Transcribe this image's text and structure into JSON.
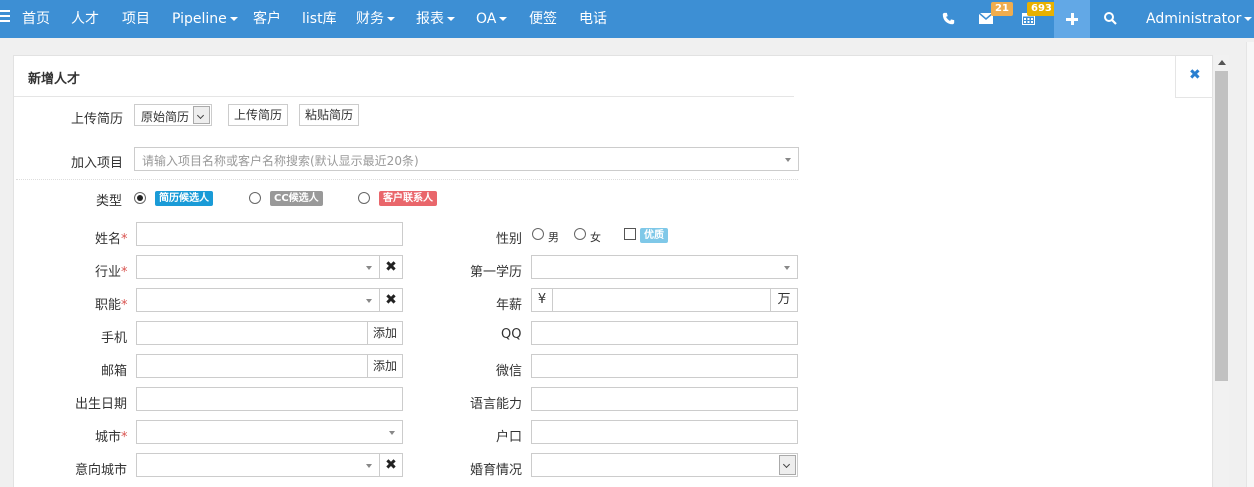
{
  "nav": {
    "items": [
      {
        "label": "首页",
        "dropdown": false
      },
      {
        "label": "人才",
        "dropdown": false
      },
      {
        "label": "项目",
        "dropdown": false
      },
      {
        "label": "Pipeline",
        "dropdown": true
      },
      {
        "label": "客户",
        "dropdown": false
      },
      {
        "label": "list库",
        "dropdown": false
      },
      {
        "label": "财务",
        "dropdown": true
      },
      {
        "label": "报表",
        "dropdown": true
      },
      {
        "label": "OA",
        "dropdown": true
      },
      {
        "label": "便签",
        "dropdown": false
      },
      {
        "label": "电话",
        "dropdown": false
      }
    ],
    "mail_badge": "21",
    "calendar_badge": "693",
    "user": "Administrator",
    "bar_color": "#3d8fd4"
  },
  "panel": {
    "title": "新增人才",
    "close_glyph": "✖"
  },
  "resume": {
    "label": "上传简历",
    "select_value": "原始简历",
    "upload_button": "上传简历",
    "paste_button": "粘贴简历"
  },
  "project": {
    "label": "加入项目",
    "placeholder": "请输入项目名称或客户名称搜索(默认显示最近20条)"
  },
  "type": {
    "label": "类型",
    "options": [
      {
        "label": "简历候选人",
        "color": "#1a9bd7",
        "selected": true
      },
      {
        "label": "CC候选人",
        "color": "#999999",
        "selected": false
      },
      {
        "label": "客户联系人",
        "color": "#e9666b",
        "selected": false
      }
    ]
  },
  "left": {
    "name": "姓名",
    "industry": "行业",
    "function": "职能",
    "mobile": "手机",
    "mobile_add": "添加",
    "email": "邮箱",
    "email_add": "添加",
    "birthday": "出生日期",
    "city": "城市",
    "target_city": "意向城市",
    "clear_glyph": "✖"
  },
  "right": {
    "gender": "性别",
    "male": "男",
    "female": "女",
    "excellent": "优质",
    "education": "第一学历",
    "salary": "年薪",
    "currency": "¥",
    "unit": "万",
    "qq": "QQ",
    "wechat": "微信",
    "language": "语言能力",
    "hukou": "户口",
    "marital": "婚育情况"
  }
}
